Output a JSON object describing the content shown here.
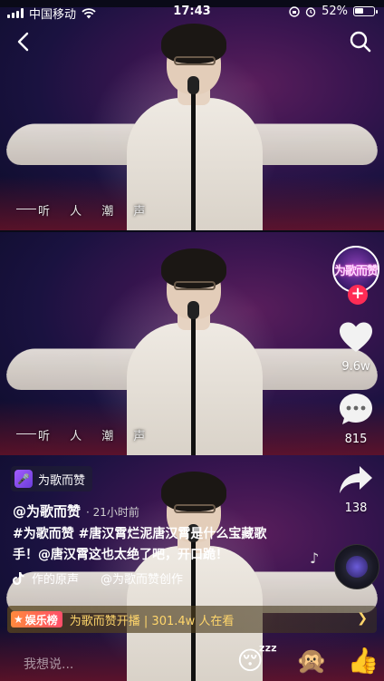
{
  "status_bar": {
    "carrier": "中国移动",
    "time": "17:43",
    "battery": "52%",
    "battery_level": 0.52
  },
  "video": {
    "subtitle": "听 人 潮 声"
  },
  "rail": {
    "avatar_text": "为歌而赞",
    "likes": "9.6w",
    "comments": "815",
    "shares": "138"
  },
  "info": {
    "tag_label": "为歌而赞",
    "author": "@为歌而赞",
    "time_ago": "· 21小时前",
    "description_line1": "#为歌而赞 #唐汉霄烂泥唐汉霄是什么宝藏歌",
    "description_line2": "手！@唐汉霄这也太绝了吧，开口跪！",
    "music_original": "作的原声",
    "music_creator": "@为歌而赞创作"
  },
  "rank": {
    "badge": "娱乐榜",
    "text": "为歌而赞开播 | 301.4w 人在看"
  },
  "input": {
    "placeholder": "我想说..."
  },
  "icons": {
    "back": "back-chevron-icon",
    "search": "search-icon",
    "like": "heart-icon",
    "comment": "comment-bubble-icon",
    "share": "share-arrow-icon",
    "music": "music-note-icon",
    "tiktok": "tiktok-logo-icon"
  },
  "colors": {
    "follow": "#fe2c55",
    "rank_text": "#ffd66b"
  }
}
